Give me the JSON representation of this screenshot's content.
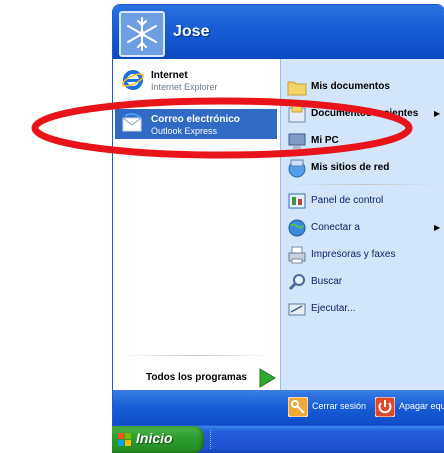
{
  "user": {
    "name": "Jose"
  },
  "left_items": [
    {
      "title": "Internet",
      "subtitle": "Internet Explorer"
    },
    {
      "title": "Correo electrónico",
      "subtitle": "Outlook Express"
    }
  ],
  "all_programs_label": "Todos los programas",
  "right_items": [
    {
      "label": "Mis documentos"
    },
    {
      "label": "Documentos recientes"
    },
    {
      "label": "Mi PC"
    },
    {
      "label": "Mis sitios de red"
    },
    {
      "label": "Panel de control"
    },
    {
      "label": "Conectar a"
    },
    {
      "label": "Impresoras y faxes"
    },
    {
      "label": "Buscar"
    },
    {
      "label": "Ejecutar..."
    }
  ],
  "bottom": {
    "logoff_label": "Cerrar sesión",
    "shutdown_label": "Apagar equipo"
  },
  "taskbar": {
    "start_label": "Inicio"
  },
  "annotation_color": "#e8141a"
}
